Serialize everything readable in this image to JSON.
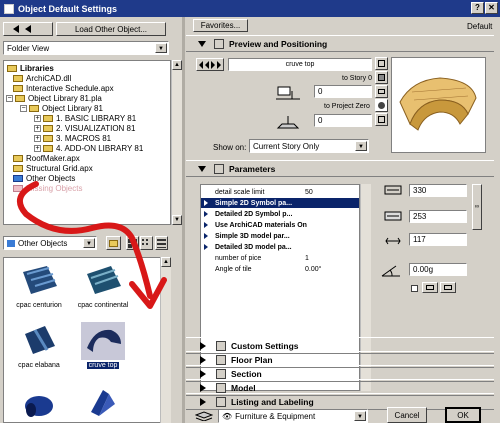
{
  "window": {
    "title": "Object Default Settings"
  },
  "left": {
    "load_button": "Load Other Object...",
    "view_combo": "Folder View",
    "tree": [
      {
        "label": "Libraries",
        "kind": "folder-open",
        "bold": true
      },
      {
        "label": "ArchiCAD.dll",
        "kind": "folder"
      },
      {
        "label": "Interactive Schedule.apx",
        "kind": "folder"
      },
      {
        "label": "Object Library 81.pla",
        "kind": "folder-open"
      },
      {
        "label": "Object Library 81",
        "kind": "folder-open"
      },
      {
        "label": "1. BASIC LIBRARY 81",
        "kind": "folder"
      },
      {
        "label": "2. VISUALIZATION 81",
        "kind": "folder"
      },
      {
        "label": "3. MACROS 81",
        "kind": "folder"
      },
      {
        "label": "4. ADD-ON LIBRARY 81",
        "kind": "folder"
      },
      {
        "label": "RoofMaker.apx",
        "kind": "folder"
      },
      {
        "label": "Structural Grid.apx",
        "kind": "folder"
      },
      {
        "label": "Other Objects",
        "kind": "folder-blue"
      },
      {
        "label": "Missing Objects",
        "kind": "folder-pink"
      }
    ],
    "filter_combo": "Other Objects",
    "thumbs": [
      {
        "label": "cpac centurion",
        "selected": false
      },
      {
        "label": "cpac continental",
        "selected": false
      },
      {
        "label": "cpac elabana",
        "selected": false
      },
      {
        "label": "cruve top",
        "selected": true
      },
      {
        "label": "",
        "selected": false
      },
      {
        "label": "",
        "selected": false
      }
    ]
  },
  "right": {
    "favorites_button": "Favorites...",
    "default_label": "Default",
    "preview_section": "Preview and Positioning",
    "object_name": "cruve top",
    "to_story": "to Story 0",
    "to_project_zero": "to Project Zero",
    "elev1": "0",
    "elev2": "0",
    "elev3": "0",
    "show_on_label": "Show on:",
    "show_on_value": "Current Story Only",
    "params_section": "Parameters",
    "params": [
      {
        "name": "detail scale limit",
        "value": "50",
        "style": "plain"
      },
      {
        "name": "Simple 2D Symbol pa...",
        "value": "",
        "style": "hl"
      },
      {
        "name": "Detailed 2D Symbol p...",
        "value": "",
        "style": "b"
      },
      {
        "name": "Use ArchiCAD materials On",
        "value": "",
        "style": "b"
      },
      {
        "name": "Simple 3D model par...",
        "value": "",
        "style": "b"
      },
      {
        "name": "Detailed 3D model pa...",
        "value": "",
        "style": "b"
      },
      {
        "name": "number of pice",
        "value": "1",
        "style": "plain"
      },
      {
        "name": "Angle of tile",
        "value": "0.00°",
        "style": "plain"
      }
    ],
    "dim_a": "330",
    "dim_b": "253",
    "dim_height": "117",
    "angle": "0.00",
    "angle_unit": "g",
    "sections": [
      "Custom Settings",
      "Floor Plan",
      "Section",
      "Model",
      "Listing and Labeling"
    ],
    "layer": "Furniture & Equipment",
    "cancel": "Cancel",
    "ok": "OK"
  },
  "annotation_color": "#d81818"
}
